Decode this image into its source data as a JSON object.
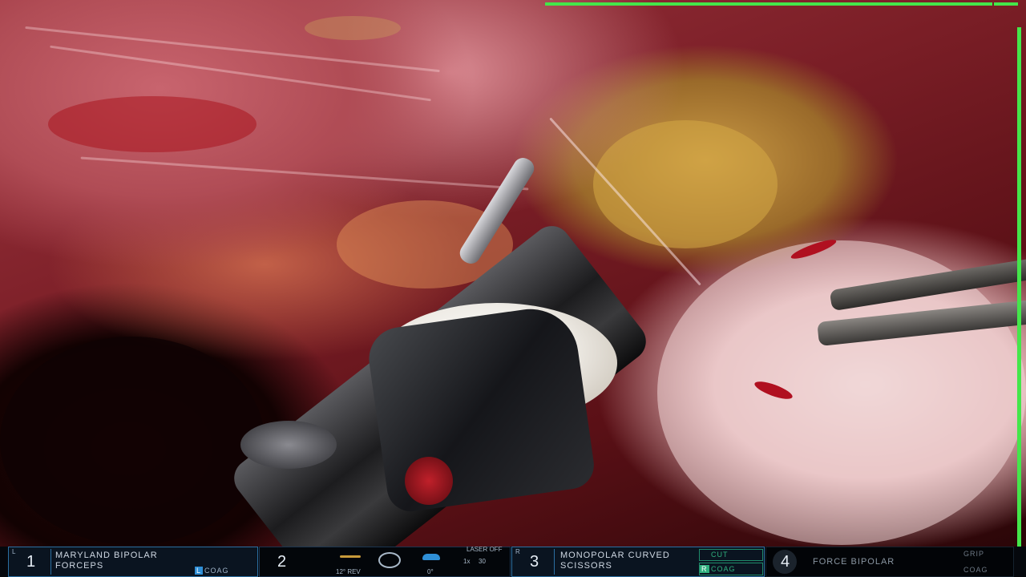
{
  "overlay": {
    "accent": "#44e64a"
  },
  "arms": [
    {
      "number": "1",
      "position_label": "L",
      "name_line1": "MARYLAND BIPOLAR",
      "name_line2": "FORCEPS",
      "pedal": "L",
      "energy": "COAG"
    },
    {
      "number": "2",
      "camera": {
        "laser": "LASER OFF",
        "rev": "12° REV",
        "angle": "0°",
        "zoom": "1x",
        "scale": "30"
      }
    },
    {
      "number": "3",
      "position_label": "R",
      "name_line1": "MONOPOLAR CURVED",
      "name_line2": "SCISSORS",
      "cut": "CUT",
      "pedal": "R",
      "energy": "COAG"
    },
    {
      "number": "4",
      "name_line1": "FORCE BIPOLAR",
      "grip": "GRIP",
      "energy": "COAG"
    }
  ]
}
